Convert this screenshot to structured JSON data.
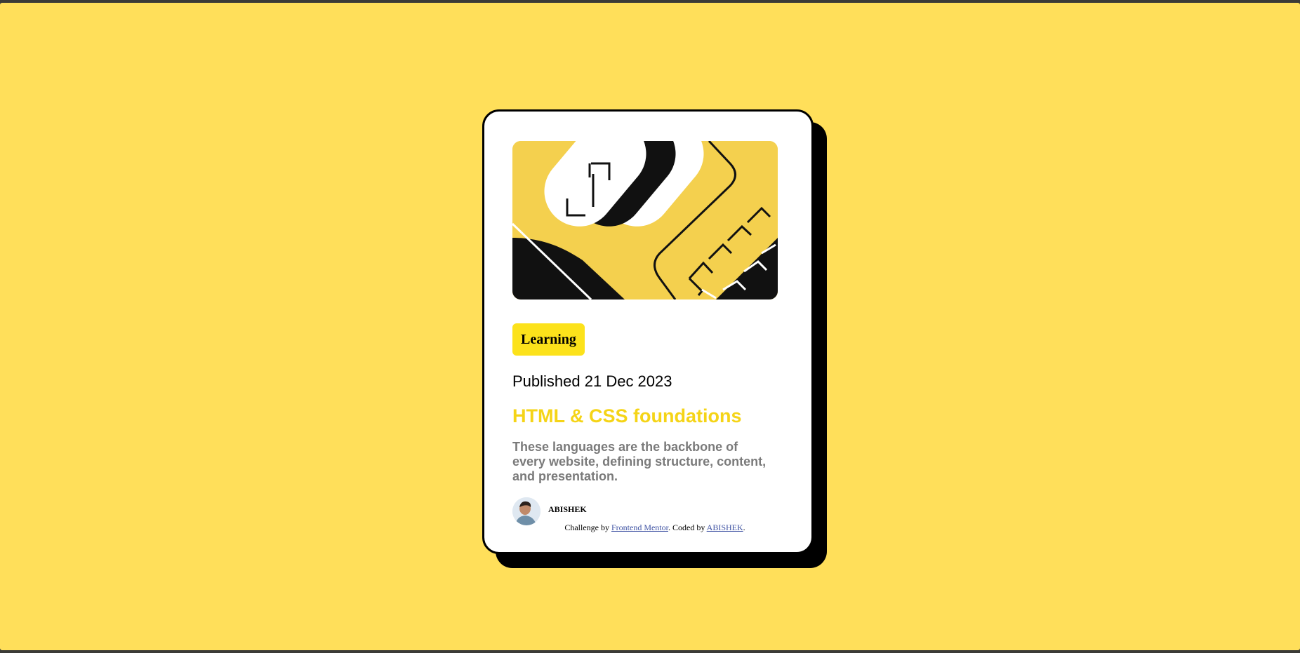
{
  "card": {
    "tag": "Learning",
    "published": "Published 21 Dec 2023",
    "title": "HTML & CSS foundations",
    "description": "These languages are the backbone of every website, defining structure, content, and presentation.",
    "author": "ABISHEK"
  },
  "attribution": {
    "prefix": "Challenge by ",
    "link1": "Frontend Mentor",
    "middle": ". Coded by ",
    "link2": "ABISHEK",
    "suffix": "."
  },
  "colors": {
    "background": "#FFDF5A",
    "accent": "#F4D04E",
    "title": "#F5D417",
    "text": "#000000",
    "muted": "#7a7a7a"
  },
  "icons": {
    "hero": "illustration-article",
    "avatar": "author-avatar"
  }
}
